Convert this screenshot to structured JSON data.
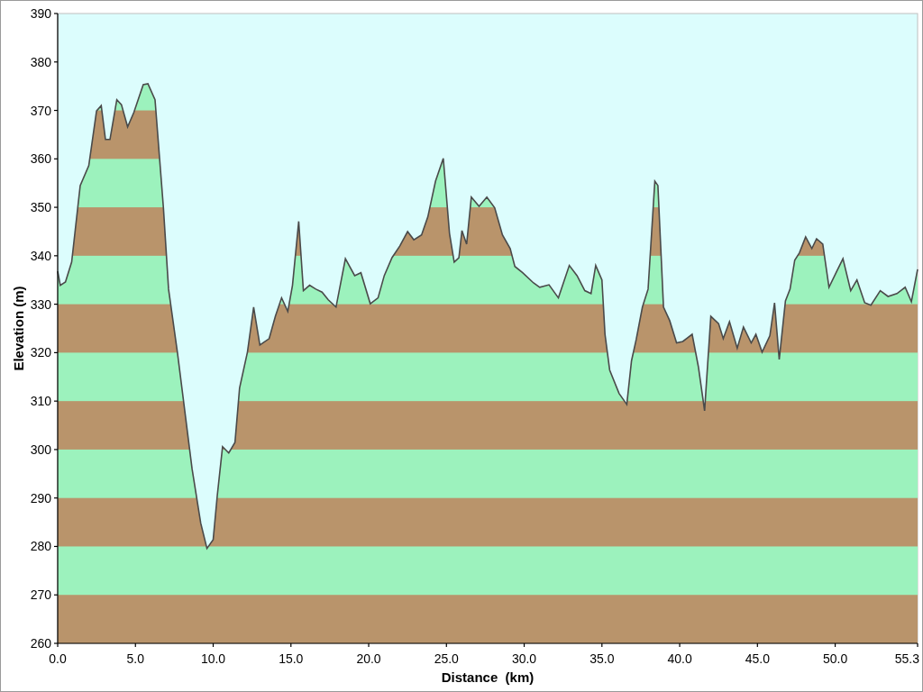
{
  "chart_data": {
    "type": "area",
    "xlabel": "Distance  (km)",
    "ylabel": "Elevation (m)",
    "xlim": [
      0,
      55.3
    ],
    "ylim": [
      260,
      390
    ],
    "xticks": [
      {
        "value": 0,
        "label": "0.0"
      },
      {
        "value": 5,
        "label": "5.0"
      },
      {
        "value": 10,
        "label": "10.0"
      },
      {
        "value": 15,
        "label": "15.0"
      },
      {
        "value": 20,
        "label": "20.0"
      },
      {
        "value": 25,
        "label": "25.0"
      },
      {
        "value": 30,
        "label": "30.0"
      },
      {
        "value": 35,
        "label": "35.0"
      },
      {
        "value": 40,
        "label": "40.0"
      },
      {
        "value": 45,
        "label": "45.0"
      },
      {
        "value": 50,
        "label": "50.0"
      },
      {
        "value": 55.3,
        "label": "55.3"
      }
    ],
    "yticks": [
      260,
      270,
      280,
      290,
      300,
      310,
      320,
      330,
      340,
      350,
      360,
      370,
      380,
      390
    ],
    "x": [
      0,
      0.17,
      0.5,
      0.9,
      1.45,
      2.0,
      2.5,
      2.8,
      3.07,
      3.36,
      3.8,
      4.1,
      4.5,
      4.9,
      5.5,
      5.8,
      6.26,
      6.8,
      7.13,
      7.7,
      8.64,
      9.2,
      9.6,
      10.0,
      10.26,
      10.6,
      11.0,
      11.4,
      11.7,
      12.2,
      12.6,
      13.0,
      13.6,
      14.0,
      14.4,
      14.8,
      15.1,
      15.5,
      15.8,
      16.2,
      16.6,
      17.0,
      17.4,
      17.9,
      18.5,
      19.1,
      19.5,
      20.1,
      20.6,
      21.0,
      21.5,
      22.0,
      22.5,
      22.9,
      23.4,
      23.8,
      24.3,
      24.8,
      25.2,
      25.5,
      25.8,
      26.0,
      26.3,
      26.6,
      27.1,
      27.6,
      28.1,
      28.6,
      29.1,
      29.4,
      29.9,
      30.6,
      31.0,
      31.6,
      32.2,
      32.9,
      33.4,
      33.9,
      34.3,
      34.6,
      35.0,
      35.2,
      35.5,
      36.1,
      36.6,
      36.9,
      37.2,
      37.6,
      37.97,
      38.4,
      38.6,
      38.96,
      39.36,
      39.8,
      40.2,
      40.8,
      41.2,
      41.6,
      42.0,
      42.5,
      42.8,
      43.2,
      43.7,
      44.1,
      44.6,
      44.9,
      45.3,
      45.8,
      46.1,
      46.4,
      46.8,
      47.1,
      47.4,
      47.7,
      48.1,
      48.5,
      48.8,
      49.2,
      49.6,
      50.1,
      50.5,
      51.0,
      51.4,
      51.9,
      52.3,
      52.9,
      53.4,
      53.97,
      54.5,
      54.9,
      55.3
    ],
    "series": [
      {
        "color": "#4a4a4a",
        "values": [
          336.8,
          333.9,
          334.6,
          338.7,
          354.5,
          358.6,
          369.9,
          371,
          364,
          364,
          372.2,
          371.2,
          366.6,
          369.6,
          375.3,
          375.5,
          372.2,
          349.9,
          333.1,
          320.1,
          296,
          284.8,
          279.6,
          281.4,
          290.4,
          300.6,
          299.3,
          301.5,
          312.7,
          320.1,
          329.4,
          321.6,
          322.9,
          327.5,
          331.3,
          328.5,
          333.9,
          347.1,
          332.8,
          333.9,
          333.1,
          332.5,
          330.9,
          329.4,
          339.4,
          335.9,
          336.5,
          330.1,
          331.3,
          335.9,
          339.6,
          342,
          345,
          343.3,
          344.3,
          348,
          355.4,
          360.1,
          344.6,
          338.7,
          339.6,
          345.2,
          342.4,
          352.1,
          350.2,
          352.1,
          349.9,
          344.3,
          341.5,
          337.8,
          336.5,
          334.4,
          333.5,
          334,
          331.3,
          338,
          335.9,
          332.8,
          332.2,
          338,
          335,
          323.8,
          316.4,
          311.6,
          309.3,
          318.3,
          322.7,
          329.4,
          333.1,
          355.4,
          354.5,
          329.4,
          326.6,
          322,
          322.3,
          323.8,
          317.1,
          308,
          327.5,
          326,
          322.9,
          326.4,
          320.9,
          325.3,
          322,
          323.8,
          320.1,
          323.5,
          330.3,
          318.6,
          330.7,
          333.1,
          339.1,
          340.6,
          343.9,
          341.5,
          343.5,
          342.4,
          333.5,
          336.8,
          339.4,
          332.8,
          335,
          330.3,
          329.8,
          332.8,
          331.6,
          332.2,
          333.5,
          330.5,
          337.2
        ]
      }
    ]
  }
}
